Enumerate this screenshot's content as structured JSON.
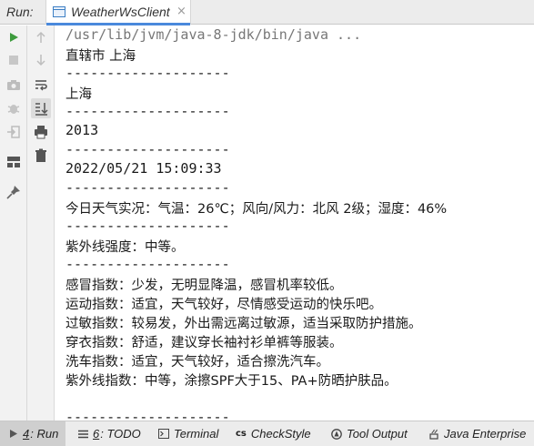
{
  "run_bar": {
    "label": "Run:",
    "tab_title": "WeatherWsClient",
    "close_glyph": "×"
  },
  "console": {
    "command": "/usr/lib/jvm/java-8-jdk/bin/java ...",
    "lines": [
      "直辖市 上海",
      "--------------------",
      "上海",
      "--------------------",
      "2013",
      "--------------------",
      "2022/05/21 15:09:33",
      "--------------------",
      "今日天气实况：气温：26℃；风向/风力：北风 2级；湿度：46%",
      "--------------------",
      "紫外线强度：中等。",
      "--------------------",
      "感冒指数：少发，无明显降温，感冒机率较低。",
      "运动指数：适宜，天气较好，尽情感受运动的快乐吧。",
      "过敏指数：较易发，外出需远离过敏源，适当采取防护措施。",
      "穿衣指数：舒适，建议穿长袖衬衫单裤等服装。",
      "洗车指数：适宜，天气较好，适合擦洗汽车。",
      "紫外线指数：中等，涂擦SPF大于15、PA+防晒护肤品。",
      "",
      "--------------------"
    ]
  },
  "left_toolbar": {
    "col1": [
      "run-icon",
      "stop-icon",
      "camera-icon",
      "debug-bug-icon",
      "exit-icon",
      "layout-icon",
      "pin-icon"
    ],
    "col2": [
      "up-arrow-icon",
      "down-arrow-icon",
      "soft-wrap-icon",
      "scroll-to-end-icon",
      "print-icon",
      "trash-icon"
    ]
  },
  "bottom_tabs": [
    {
      "num": "4",
      "label": ": Run",
      "icon": "run-icon",
      "active": true
    },
    {
      "num": "6",
      "label": ": TODO",
      "icon": "todo-icon",
      "active": false
    },
    {
      "num": "",
      "label": "Terminal",
      "icon": "terminal-icon",
      "active": false
    },
    {
      "num": "",
      "label": "CheckStyle",
      "icon": "checkstyle-icon",
      "active": false
    },
    {
      "num": "",
      "label": "Tool Output",
      "icon": "tool-output-icon",
      "active": false
    },
    {
      "num": "",
      "label": "Java Enterprise",
      "icon": "java-enterprise-icon",
      "active": false
    }
  ],
  "colors": {
    "run_green": "#3d9b3d",
    "accent_blue": "#4a89dc",
    "command_gray": "#777777"
  }
}
